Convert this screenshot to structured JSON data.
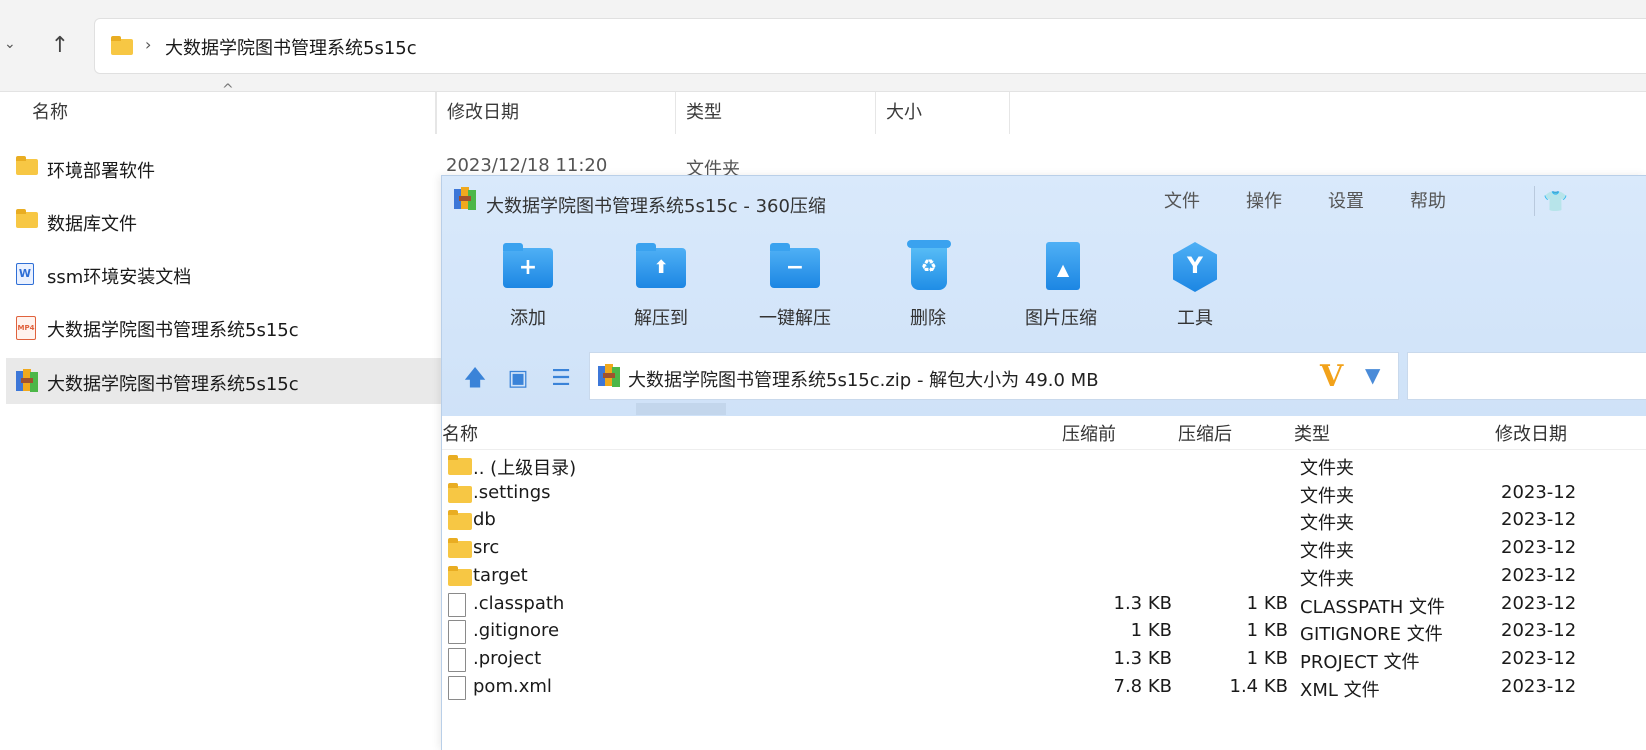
{
  "explorer": {
    "address": {
      "path": "大数据学院图书管理系统5s15c"
    },
    "columns": [
      "名称",
      "修改日期",
      "类型",
      "大小"
    ],
    "items": [
      {
        "name": "环境部署软件",
        "icon": "folder-icon",
        "date": "2023/12/18 11:20",
        "type": "文件夹"
      },
      {
        "name": "数据库文件",
        "icon": "folder-icon"
      },
      {
        "name": "ssm环境安装文档",
        "icon": "word-doc-icon",
        "icon_text": "W"
      },
      {
        "name": "大数据学院图书管理系统5s15c",
        "icon": "mp4-video-icon",
        "icon_text": "MP4"
      },
      {
        "name": "大数据学院图书管理系统5s15c",
        "icon": "zip-archive-icon",
        "selected": true
      }
    ]
  },
  "zipwin": {
    "title": "大数据学院图书管理系统5s15c - 360压缩",
    "menu": [
      "文件",
      "操作",
      "设置",
      "帮助"
    ],
    "skin_icon": "👕",
    "tools": [
      {
        "label": "添加",
        "icon": "add-icon",
        "glyph": "+"
      },
      {
        "label": "解压到",
        "icon": "extract-to-icon",
        "glyph": "⬆"
      },
      {
        "label": "一键解压",
        "icon": "one-click-extract-icon",
        "glyph": "−"
      },
      {
        "label": "删除",
        "icon": "delete-icon",
        "glyph": "♻"
      },
      {
        "label": "图片压缩",
        "icon": "image-compress-icon",
        "glyph": "▲"
      },
      {
        "label": "工具",
        "icon": "tools-icon",
        "glyph": "Y"
      }
    ],
    "nav": {
      "up_glyph": "🡅",
      "view_glyph": "▣",
      "list_glyph": "☰"
    },
    "path": {
      "text": "大数据学院图书管理系统5s15c.zip - 解包大小为 49.0 MB",
      "v_glyph": "V",
      "dropdown_glyph": "▼"
    },
    "columns": [
      "名称",
      "压缩前",
      "压缩后",
      "类型",
      "修改日期"
    ],
    "rows": [
      {
        "name": ".. (上级目录)",
        "kind": "folder",
        "before": "",
        "after": "",
        "type": "文件夹",
        "date": ""
      },
      {
        "name": ".settings",
        "kind": "folder",
        "before": "",
        "after": "",
        "type": "文件夹",
        "date": "2023-12"
      },
      {
        "name": "db",
        "kind": "folder",
        "before": "",
        "after": "",
        "type": "文件夹",
        "date": "2023-12"
      },
      {
        "name": "src",
        "kind": "folder",
        "before": "",
        "after": "",
        "type": "文件夹",
        "date": "2023-12"
      },
      {
        "name": "target",
        "kind": "folder",
        "before": "",
        "after": "",
        "type": "文件夹",
        "date": "2023-12"
      },
      {
        "name": ".classpath",
        "kind": "file",
        "before": "1.3 KB",
        "after": "1 KB",
        "type": "CLASSPATH 文件",
        "date": "2023-12"
      },
      {
        "name": ".gitignore",
        "kind": "file",
        "before": "1 KB",
        "after": "1 KB",
        "type": "GITIGNORE 文件",
        "date": "2023-12"
      },
      {
        "name": ".project",
        "kind": "file",
        "before": "1.3 KB",
        "after": "1 KB",
        "type": "PROJECT 文件",
        "date": "2023-12"
      },
      {
        "name": "pom.xml",
        "kind": "file",
        "before": "7.8 KB",
        "after": "1.4 KB",
        "type": "XML 文件",
        "date": "2023-12"
      }
    ]
  }
}
